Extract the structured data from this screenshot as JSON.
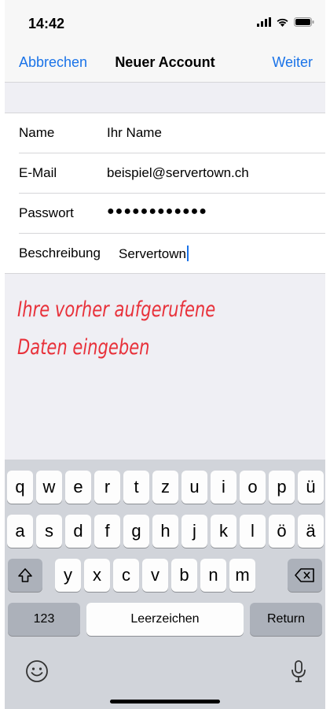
{
  "status": {
    "time": "14:42"
  },
  "nav": {
    "cancel": "Abbrechen",
    "title": "Neuer Account",
    "next": "Weiter"
  },
  "form": {
    "rows": [
      {
        "label": "Name",
        "value": "Ihr Name"
      },
      {
        "label": "E-Mail",
        "value": "beispiel@servertown.ch"
      },
      {
        "label": "Passwort",
        "value": "●●●●●●●●●●●●"
      },
      {
        "label": "Beschreibung",
        "value": "Servertown"
      }
    ]
  },
  "note": {
    "line1": "Ihre vorher aufgerufene",
    "line2": "Daten eingeben"
  },
  "keyboard": {
    "row1": [
      "q",
      "w",
      "e",
      "r",
      "t",
      "z",
      "u",
      "i",
      "o",
      "p",
      "ü"
    ],
    "row2": [
      "a",
      "s",
      "d",
      "f",
      "g",
      "h",
      "j",
      "k",
      "l",
      "ö",
      "ä"
    ],
    "row3": [
      "y",
      "x",
      "c",
      "v",
      "b",
      "n",
      "m"
    ],
    "numbers": "123",
    "space": "Leerzeichen",
    "return": "Return"
  },
  "icons": {
    "signal": "signal-icon",
    "wifi": "wifi-icon",
    "battery": "battery-icon",
    "shift": "shift-icon",
    "backspace": "backspace-icon",
    "emoji": "emoji-icon",
    "mic": "microphone-icon"
  },
  "colors": {
    "accent": "#1a73e8",
    "note": "#e8313a",
    "keyboard_bg": "#d1d4da"
  }
}
